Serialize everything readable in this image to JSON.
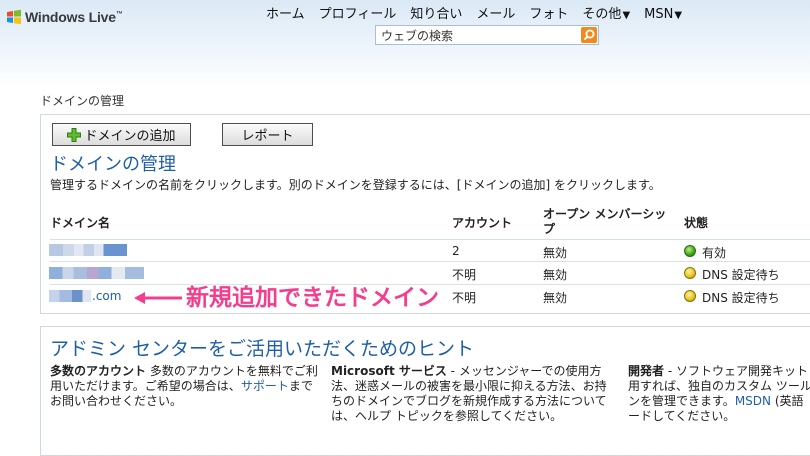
{
  "header": {
    "logo_text": "Windows Live",
    "logo_tm": "™",
    "nav": [
      {
        "label": "ホーム"
      },
      {
        "label": "プロフィール"
      },
      {
        "label": "知り合い"
      },
      {
        "label": "メール"
      },
      {
        "label": "フォト"
      },
      {
        "label": "その他",
        "caret": "▼"
      },
      {
        "label": "MSN",
        "caret": "▼"
      }
    ],
    "search": {
      "placeholder": "ウェブの検索"
    }
  },
  "breadcrumb": "ドメインの管理",
  "toolbar": {
    "add_label": "ドメインの追加",
    "report_label": "レポート"
  },
  "page": {
    "title": "ドメインの管理",
    "instructions": "管理するドメインの名前をクリックします。別のドメインを登録するには、[ドメインの追加] をクリックします。"
  },
  "table": {
    "headers": {
      "domain": "ドメイン名",
      "account": "アカウント",
      "open_membership_line1": "オープン メンバーシッ",
      "open_membership_line2": "プ",
      "status": "状態"
    },
    "rows": [
      {
        "domain": "",
        "account": "2",
        "open": "無効",
        "status": "有効",
        "status_color": "#3ca21a"
      },
      {
        "domain": "",
        "account": "不明",
        "open": "無効",
        "status": "DNS 設定待ち",
        "status_color": "#e3c21c"
      },
      {
        "domain": ".com",
        "account": "不明",
        "open": "無効",
        "status": "DNS 設定待ち",
        "status_color": "#e3c21c"
      }
    ]
  },
  "annotation": {
    "text": "新規追加できたドメイン",
    "color": "#f43d8c"
  },
  "hints": {
    "title": "アドミン センターをご活用いただくためのヒント",
    "col1": {
      "bold": "多数のアカウント",
      "line1": " 多数のアカウントを無料でご利",
      "line2_a": "用いただけます。ご希望の場合は、",
      "link": "サポート",
      "line2_b": "まで",
      "line3": "お問い合わせください。"
    },
    "col2": {
      "bold": "Microsoft サービス",
      "line1": " - メッセンジャーでの使用方",
      "line2": "法、迷惑メールの被害を最小限に抑える方法、お持",
      "line3": "ちのドメインでブログを新規作成する方法について",
      "line4": "は、ヘルプ トピックを参照してください。"
    },
    "col3": {
      "bold": "開発者",
      "line1": " - ソフトウェア開発キット",
      "line2": "用すれば、独自のカスタム ツール",
      "line3_a": "ンを管理できます。",
      "link": "MSDN",
      "line3_b": " (英語",
      "line4": "ードしてください。"
    }
  }
}
